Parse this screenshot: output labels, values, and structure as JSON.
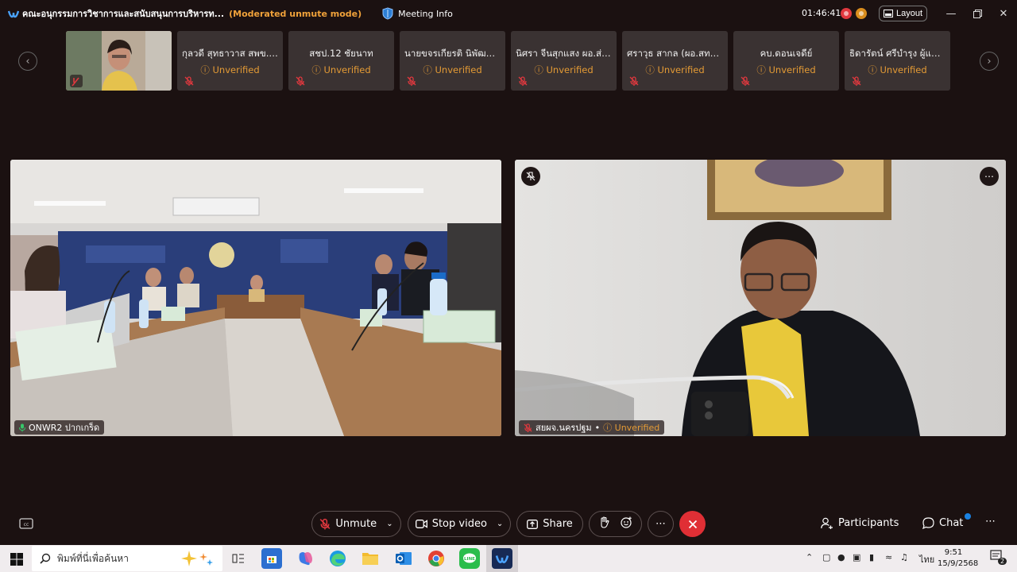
{
  "titlebar": {
    "app_title": "คณะอนุกรรมการวิชาการและสนับสนุนการบริหารท...",
    "mode": "(Moderated unmute mode)",
    "meeting_info": "Meeting Info",
    "timer": "01:46:41",
    "layout_label": "Layout"
  },
  "strip": {
    "participants": [
      {
        "name": "กุลวดี สุทธาวาส สพข.10",
        "status": "Unverified"
      },
      {
        "name": "สชป.12 ชัยนาท",
        "status": "Unverified"
      },
      {
        "name": "นายขจรเกียรติ นิพัฒน์โ...",
        "status": "Unverified"
      },
      {
        "name": "นิศรา จีนสุกแสง ผอ.ส่ว...",
        "status": "Unverified"
      },
      {
        "name": "ศราวุธ  สากล (ผอ.สทน...",
        "status": "Unverified"
      },
      {
        "name": "คบ.ดอนเจดีย์",
        "status": "Unverified"
      },
      {
        "name": "ธิดารัตน์ ศรีบำรุง ผู้แทน...",
        "status": "Unverified"
      }
    ]
  },
  "videos": {
    "left_name": "ONWR2 ปากเกร็ด",
    "right_name": "สยผจ.นครปฐม",
    "right_status": "Unverified"
  },
  "toolbar": {
    "unmute": "Unmute",
    "stop_video": "Stop video",
    "share": "Share",
    "participants": "Participants",
    "chat": "Chat"
  },
  "taskbar": {
    "search_placeholder": "พิมพ์ที่นี่เพื่อค้นหา",
    "lang": "ไทย",
    "time": "9:51",
    "date": "15/9/2568",
    "notification_count": "2"
  },
  "colors": {
    "accent_orange": "#e49b35",
    "end_red": "#e02f35",
    "background": "#1b1111"
  }
}
